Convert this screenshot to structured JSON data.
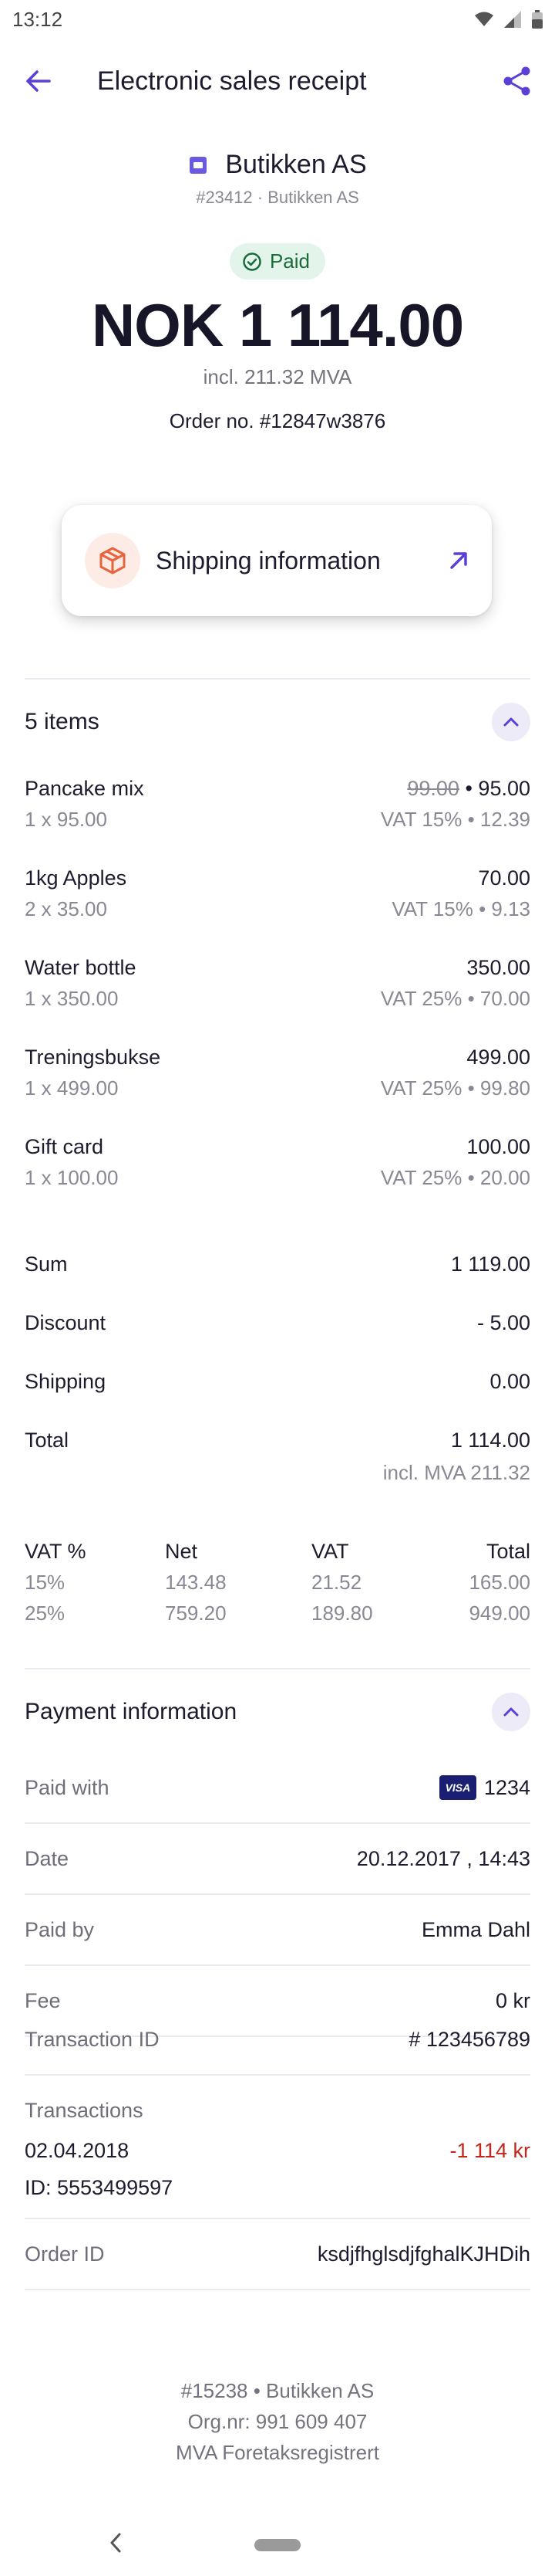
{
  "status_bar": {
    "time": "13:12"
  },
  "header": {
    "title": "Electronic sales receipt"
  },
  "merchant": {
    "name": "Butikken AS",
    "sub": "#23412 · Butikken AS"
  },
  "receipt": {
    "status": "Paid",
    "amount": "NOK 1 114.00",
    "incl": "incl. 211.32 MVA",
    "order_no": "Order no. #12847w3876"
  },
  "shipping": {
    "label": "Shipping information"
  },
  "items_section": {
    "title": "5 items",
    "items": [
      {
        "name": "Pancake mix",
        "qty": "1 x 95.00",
        "old_price": "99.00",
        "sep": " • ",
        "price": "95.00",
        "vat": "VAT 15% • 12.39"
      },
      {
        "name": "1kg Apples",
        "qty": "2 x 35.00",
        "old_price": "",
        "sep": "",
        "price": "70.00",
        "vat": "VAT 15% • 9.13"
      },
      {
        "name": "Water bottle",
        "qty": "1 x 350.00",
        "old_price": "",
        "sep": "",
        "price": "350.00",
        "vat": "VAT 25% • 70.00"
      },
      {
        "name": "Treningsbukse",
        "qty": "1 x 499.00",
        "old_price": "",
        "sep": "",
        "price": "499.00",
        "vat": "VAT 25% • 99.80"
      },
      {
        "name": "Gift card",
        "qty": "1 x 100.00",
        "old_price": "",
        "sep": "",
        "price": "100.00",
        "vat": "VAT 25% • 20.00"
      }
    ]
  },
  "totals": {
    "sum_label": "Sum",
    "sum": "1 119.00",
    "discount_label": "Discount",
    "discount": "- 5.00",
    "shipping_label": "Shipping",
    "shipping": "0.00",
    "total_label": "Total",
    "total": "1 114.00",
    "total_sub": "incl. MVA 211.32"
  },
  "vat_table": {
    "headers": [
      "VAT %",
      "Net",
      "VAT",
      "Total"
    ],
    "rows": [
      [
        "15%",
        "143.48",
        "21.52",
        "165.00"
      ],
      [
        "25%",
        "759.20",
        "189.80",
        "949.00"
      ]
    ]
  },
  "payment": {
    "title": "Payment information",
    "paid_with_label": "Paid with",
    "card_brand": "VISA",
    "card_last4": "1234",
    "date_label": "Date",
    "date": "20.12.2017 , 14:43",
    "paid_by_label": "Paid by",
    "paid_by": "Emma Dahl",
    "fee_label": "Fee",
    "fee": "0 kr",
    "transaction_id_label": "Transaction ID",
    "transaction_id": "# 123456789",
    "transactions_label": "Transactions",
    "transaction_date": "02.04.2018",
    "transaction_ref": "ID: 5553499597",
    "transaction_amount": "-1 114 kr",
    "order_id_label": "Order ID",
    "order_id": "ksdjfhglsdjfghalKJHDih"
  },
  "footer": {
    "line1": "#15238 • Butikken AS",
    "line2": "Org.nr: 991 609 407",
    "line3": "MVA Foretaksregistrert"
  },
  "colors": {
    "accent": "#5b3fd6",
    "paid_bg": "#e3f4ea",
    "paid_text": "#1b6b3a",
    "negative": "#c2261c",
    "shipping_icon": "#e8643c"
  },
  "icons": [
    "wifi-icon",
    "signal-icon",
    "battery-icon",
    "back-arrow-icon",
    "share-icon",
    "store-icon",
    "check-circle-icon",
    "package-icon",
    "arrow-up-right-icon",
    "chevron-up-icon",
    "visa-card-icon",
    "nav-back-icon",
    "home-pill-icon"
  ]
}
